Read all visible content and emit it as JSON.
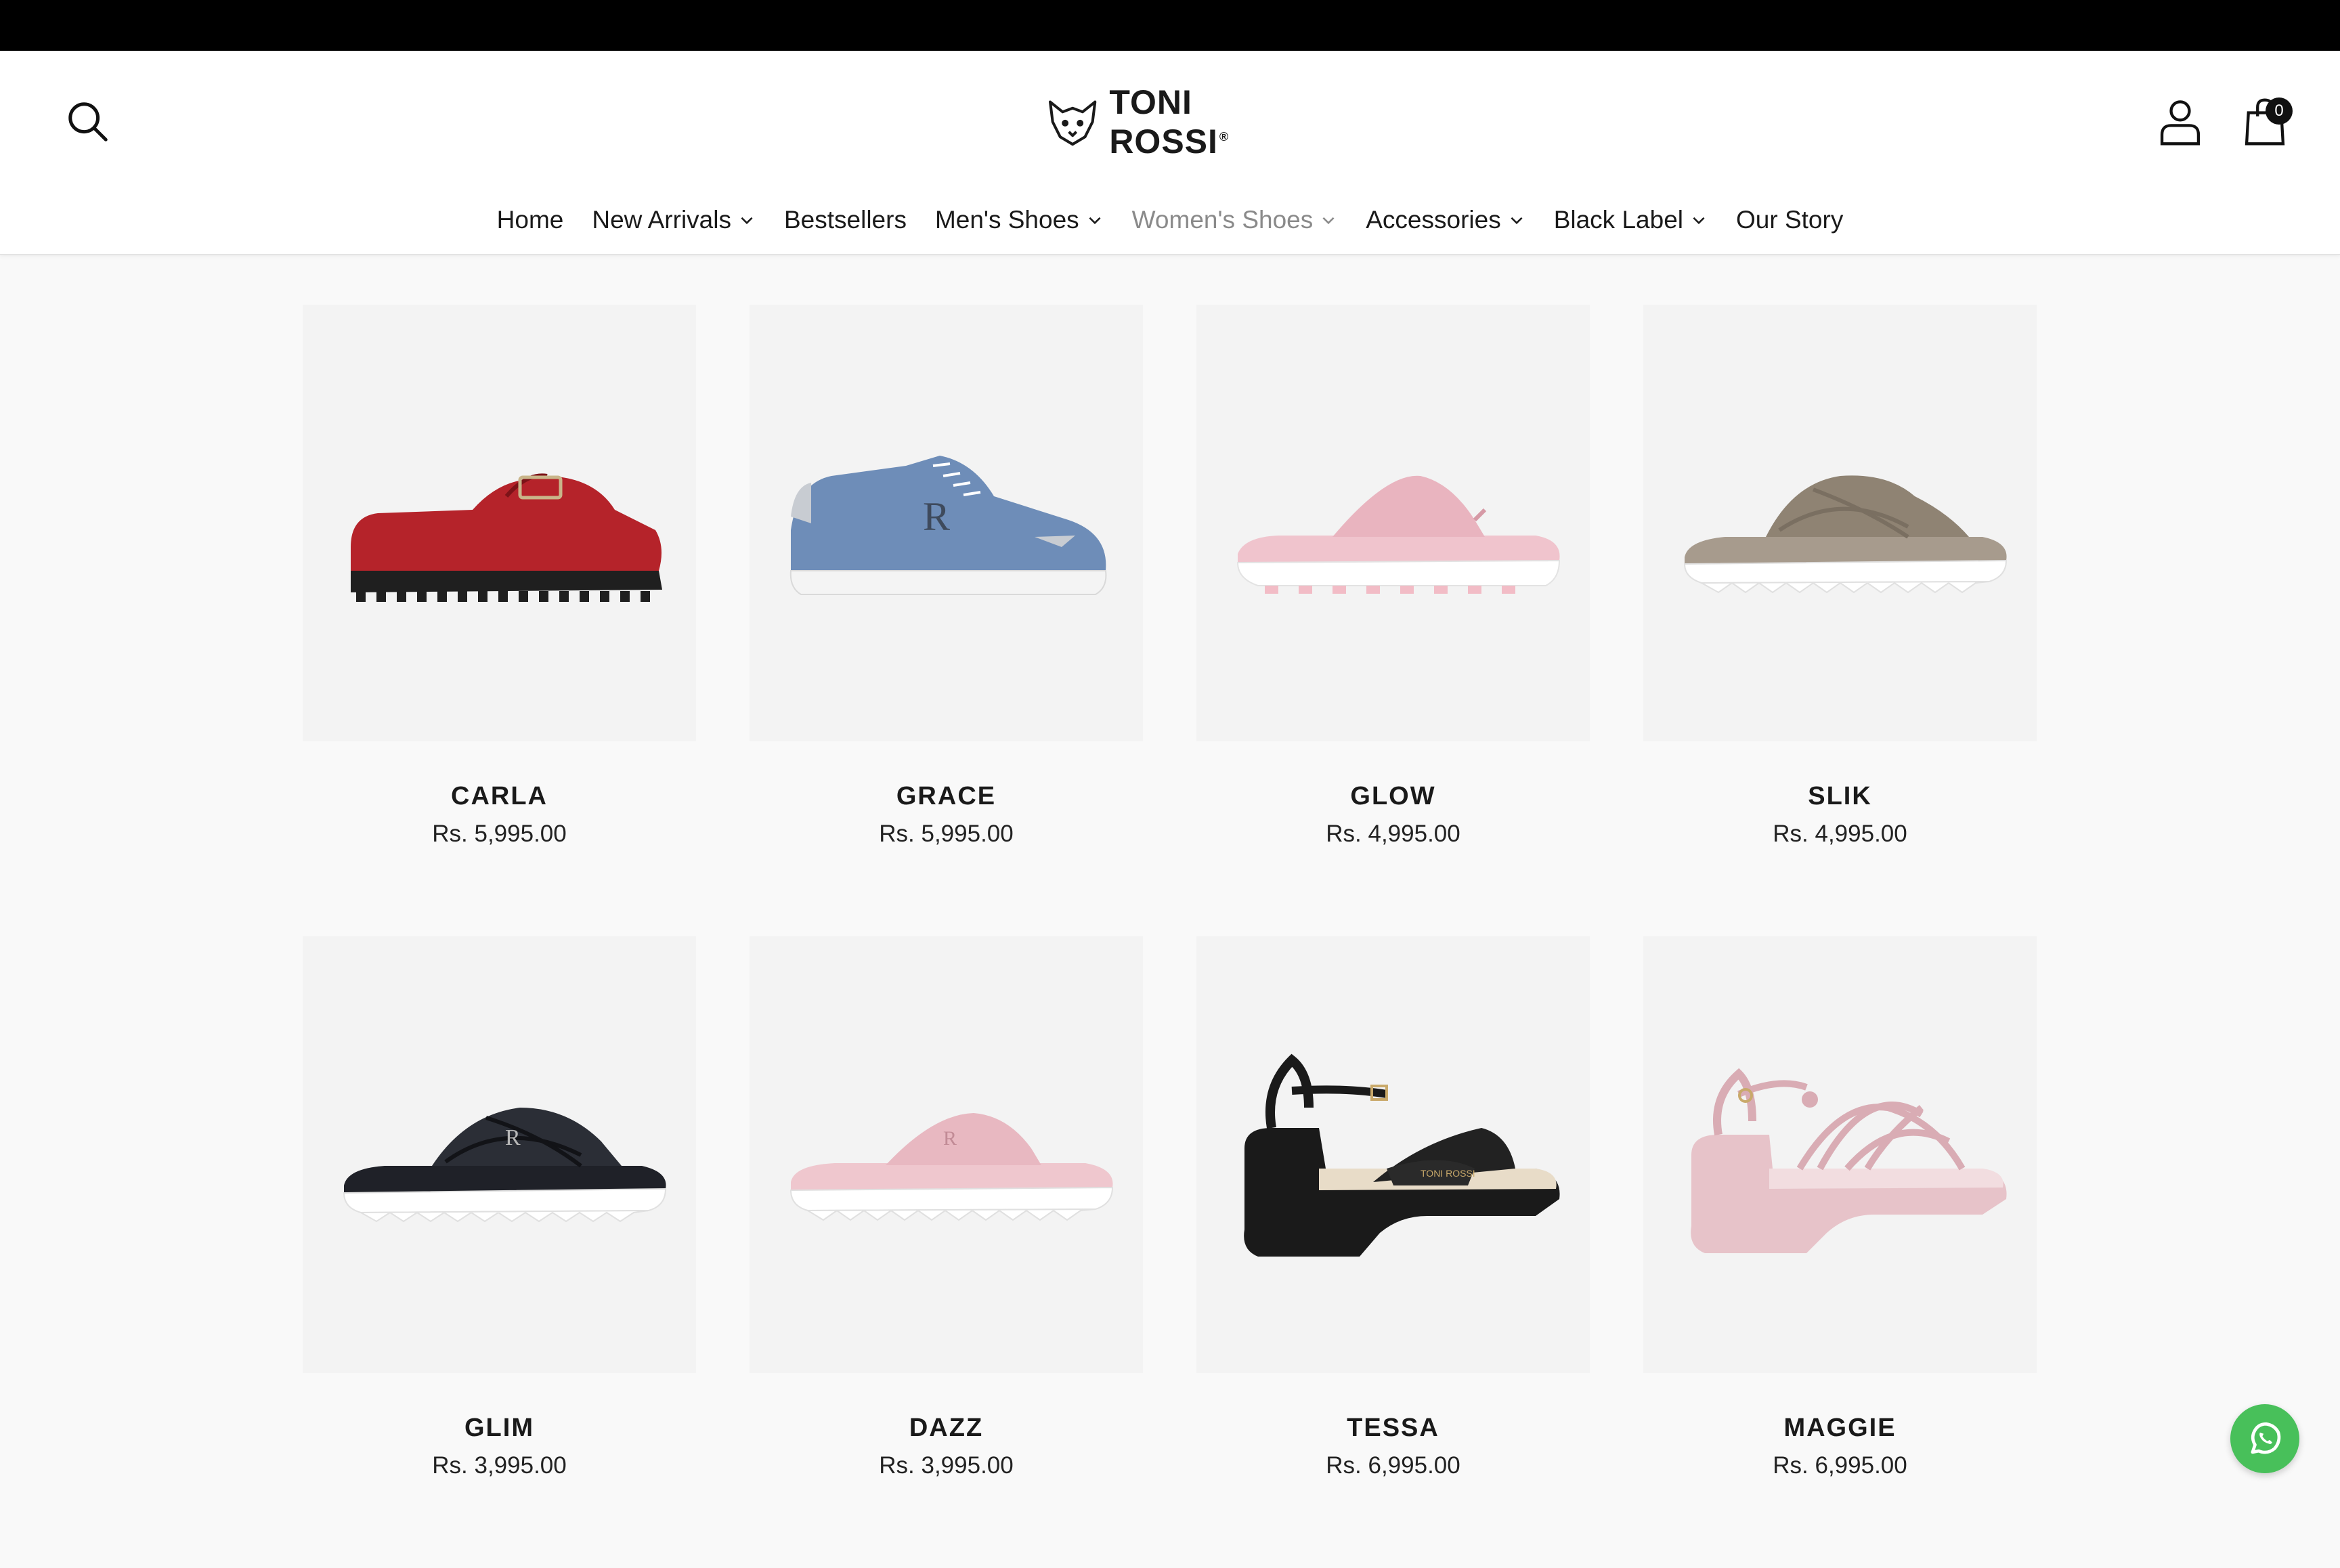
{
  "colors": {
    "topbar": "#000000",
    "header_bg": "#ffffff",
    "page_bg": "#f9f9f9",
    "muted_nav": "#8a8a8a",
    "whatsapp": "#48c05a"
  },
  "header": {
    "logo_text": "TONI ROSSI",
    "logo_mark": "®",
    "cart_count": "0",
    "icons": [
      "search-icon",
      "account-icon",
      "bag-icon"
    ]
  },
  "nav": {
    "items": [
      {
        "label": "Home",
        "has_dropdown": false,
        "active": false
      },
      {
        "label": "New Arrivals",
        "has_dropdown": true,
        "active": false
      },
      {
        "label": "Bestsellers",
        "has_dropdown": false,
        "active": false
      },
      {
        "label": "Men's Shoes",
        "has_dropdown": true,
        "active": false
      },
      {
        "label": "Women's Shoes",
        "has_dropdown": true,
        "active": true
      },
      {
        "label": "Accessories",
        "has_dropdown": true,
        "active": false
      },
      {
        "label": "Black Label",
        "has_dropdown": true,
        "active": false
      },
      {
        "label": "Our Story",
        "has_dropdown": false,
        "active": false
      }
    ]
  },
  "products": [
    {
      "name": "CARLA",
      "price": "Rs. 5,995.00",
      "image": "red-loafer"
    },
    {
      "name": "GRACE",
      "price": "Rs. 5,995.00",
      "image": "blue-sneaker"
    },
    {
      "name": "GLOW",
      "price": "Rs. 4,995.00",
      "image": "pink-flip-flop"
    },
    {
      "name": "SLIK",
      "price": "Rs. 4,995.00",
      "image": "taupe-slide"
    },
    {
      "name": "GLIM",
      "price": "Rs. 3,995.00",
      "image": "black-slide"
    },
    {
      "name": "DAZZ",
      "price": "Rs. 3,995.00",
      "image": "pink-flip-flop-flat"
    },
    {
      "name": "TESSA",
      "price": "Rs. 6,995.00",
      "image": "black-platform-sandal"
    },
    {
      "name": "MAGGIE",
      "price": "Rs. 6,995.00",
      "image": "pink-platform-sandal"
    }
  ],
  "floating": {
    "icon": "whatsapp-icon"
  }
}
